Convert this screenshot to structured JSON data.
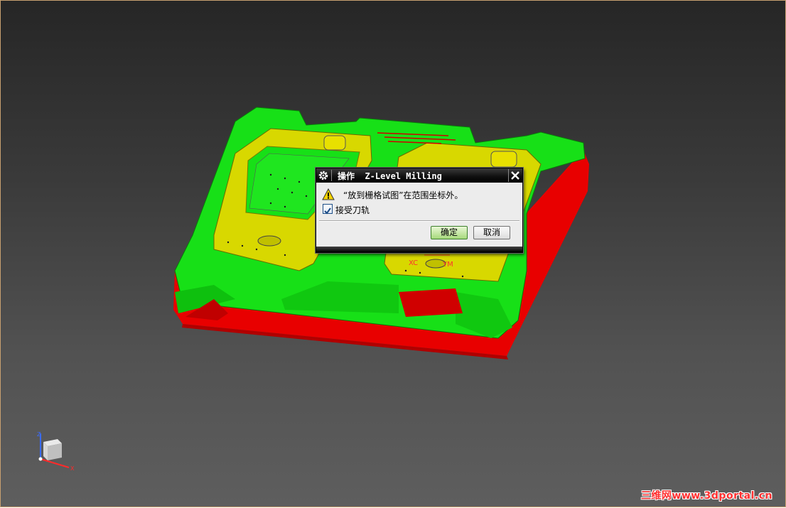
{
  "dialog": {
    "title": "操作  Z-Level Milling",
    "message": "“放到栅格试图”在范围坐标外。",
    "checkbox_label": "接受刀轨",
    "checkbox_checked": true,
    "ok_label": "确定",
    "cancel_label": "取消"
  },
  "viewport": {
    "wcs_label": "XC",
    "wcs_label_2": "YM",
    "triad_x": "X",
    "triad_y": "Y",
    "triad_z": "Z"
  },
  "watermark": "三维网www.3dportal.cn",
  "colors": {
    "green": "#17e017",
    "red": "#e80000",
    "yellow": "#d8d800",
    "ok_button": "#a6d97b"
  },
  "icons": [
    "gear-icon",
    "close-icon",
    "warning-icon",
    "checkmark-icon"
  ]
}
